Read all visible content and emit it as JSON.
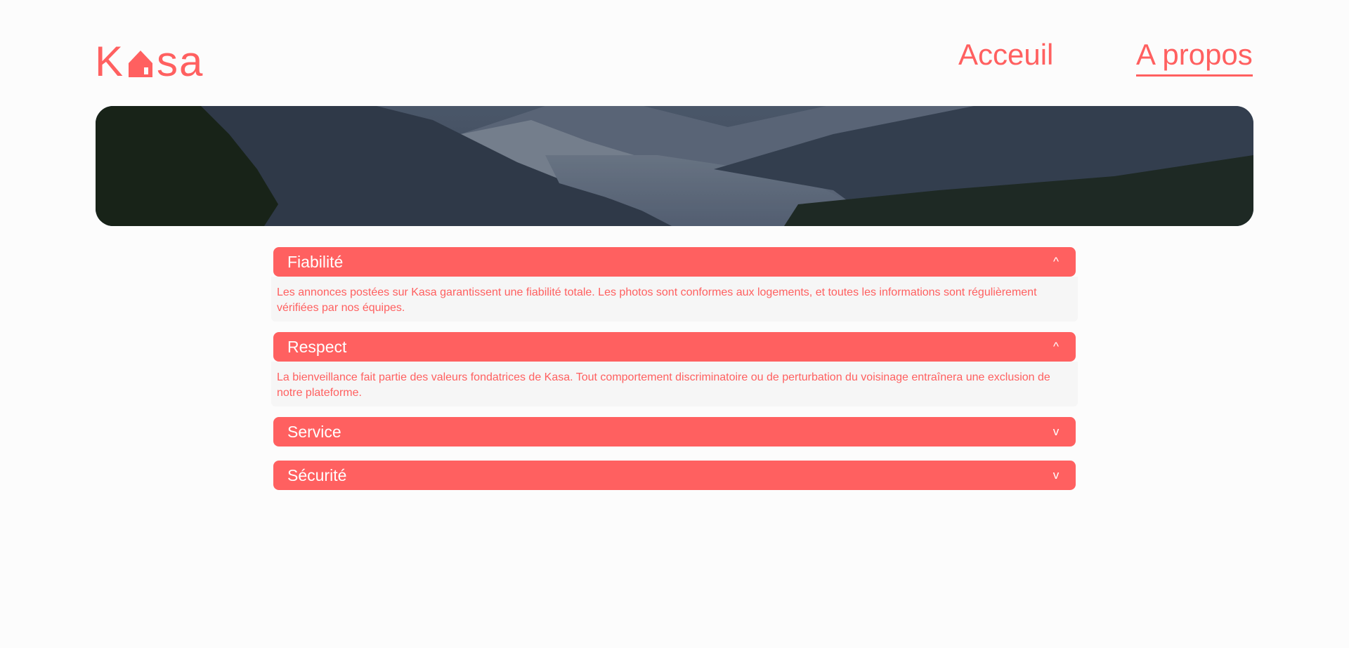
{
  "header": {
    "logo_text_start": "K",
    "logo_text_end": "sa",
    "nav": {
      "home_label": "Acceuil",
      "about_label": "A propos"
    }
  },
  "colors": {
    "accent": "#ff6060",
    "body_bg": "#fcfcfc",
    "panel_bg": "#f6f6f6"
  },
  "accordions": [
    {
      "title": "Fiabilité",
      "chevron": "^",
      "expanded": true,
      "content": "Les annonces postées sur Kasa garantissent une fiabilité totale. Les photos sont conformes aux logements, et toutes les informations sont régulièrement vérifiées par nos équipes."
    },
    {
      "title": "Respect",
      "chevron": "^",
      "expanded": true,
      "content": "La bienveillance fait partie des valeurs fondatrices de Kasa. Tout comportement discriminatoire ou de perturbation du voisinage entraînera une exclusion de notre plateforme."
    },
    {
      "title": "Service",
      "chevron": "v",
      "expanded": false
    },
    {
      "title": "Sécurité",
      "chevron": "v",
      "expanded": false
    }
  ],
  "icons": {
    "logo_house": "house-icon",
    "banner": "mountain-landscape-image"
  }
}
